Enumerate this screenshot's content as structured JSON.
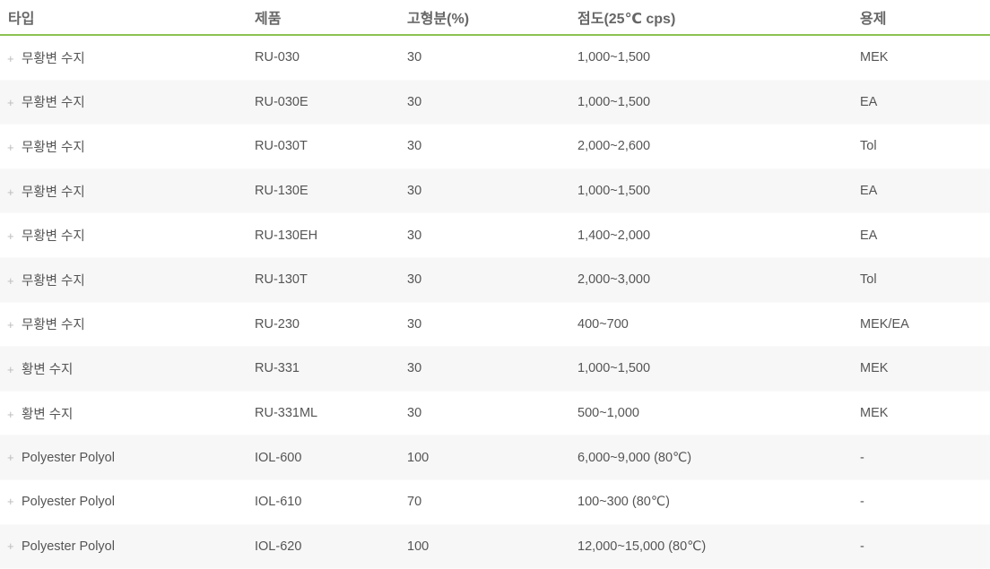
{
  "table": {
    "headers": {
      "type": "타입",
      "product": "제품",
      "solids": "고형분(%)",
      "viscosity": "점도(25℃ cps)",
      "solvent": "용제"
    },
    "rows": [
      {
        "type": "무황변 수지",
        "product": "RU-030",
        "solids": "30",
        "viscosity": "1,000~1,500",
        "solvent": "MEK"
      },
      {
        "type": "무황변 수지",
        "product": "RU-030E",
        "solids": "30",
        "viscosity": "1,000~1,500",
        "solvent": "EA"
      },
      {
        "type": "무황변 수지",
        "product": "RU-030T",
        "solids": "30",
        "viscosity": "2,000~2,600",
        "solvent": "Tol"
      },
      {
        "type": "무황변 수지",
        "product": "RU-130E",
        "solids": "30",
        "viscosity": "1,000~1,500",
        "solvent": "EA"
      },
      {
        "type": "무황변 수지",
        "product": "RU-130EH",
        "solids": "30",
        "viscosity": "1,400~2,000",
        "solvent": "EA"
      },
      {
        "type": "무황변 수지",
        "product": "RU-130T",
        "solids": "30",
        "viscosity": "2,000~3,000",
        "solvent": "Tol"
      },
      {
        "type": "무황변 수지",
        "product": "RU-230",
        "solids": "30",
        "viscosity": "400~700",
        "solvent": "MEK/EA"
      },
      {
        "type": "황변 수지",
        "product": "RU-331",
        "solids": "30",
        "viscosity": "1,000~1,500",
        "solvent": "MEK"
      },
      {
        "type": "황변 수지",
        "product": "RU-331ML",
        "solids": "30",
        "viscosity": "500~1,000",
        "solvent": "MEK"
      },
      {
        "type": "Polyester Polyol",
        "product": "IOL-600",
        "solids": "100",
        "viscosity": "6,000~9,000 (80℃)",
        "solvent": "-"
      },
      {
        "type": "Polyester Polyol",
        "product": "IOL-610",
        "solids": "70",
        "viscosity": "100~300 (80℃)",
        "solvent": "-"
      },
      {
        "type": "Polyester Polyol",
        "product": "IOL-620",
        "solids": "100",
        "viscosity": "12,000~15,000 (80℃)",
        "solvent": "-"
      }
    ]
  },
  "icons": {
    "row_expand": "plus-icon",
    "row_expand_glyph": "+"
  },
  "colors": {
    "header_rule": "#8cc152",
    "zebra_row": "#f7f7f7",
    "text": "#555555"
  }
}
